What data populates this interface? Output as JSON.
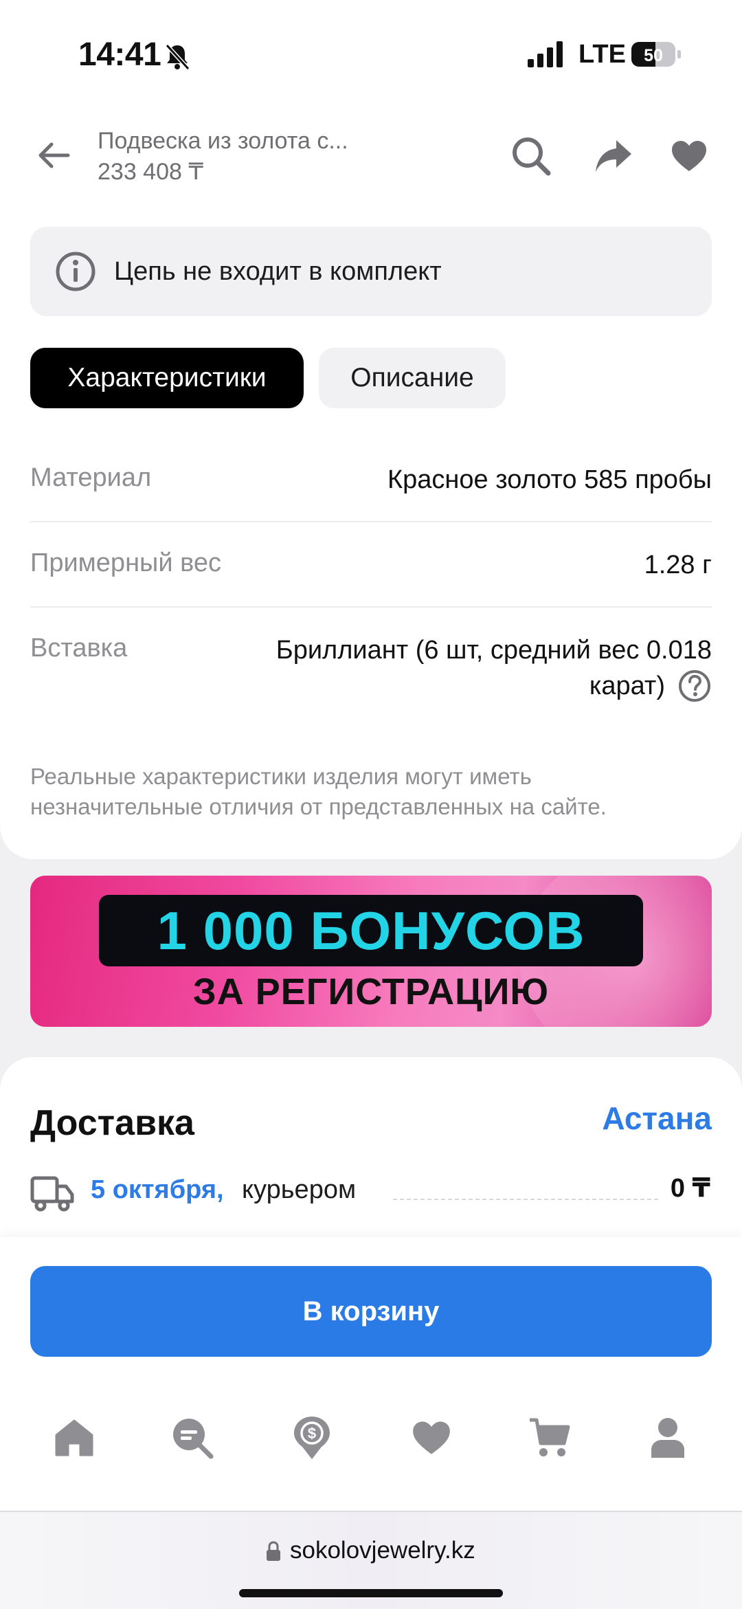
{
  "status_bar": {
    "time": "14:41",
    "network": "LTE",
    "battery": "50"
  },
  "header": {
    "title": "Подвеска из золота с...",
    "price": "233 408 ₸"
  },
  "notice": {
    "text": "Цепь не входит в комплект"
  },
  "tabs": [
    {
      "label": "Характеристики",
      "active": true
    },
    {
      "label": "Описание",
      "active": false
    }
  ],
  "specs": [
    {
      "label": "Материал",
      "value": "Красное золото 585 пробы"
    },
    {
      "label": "Примерный вес",
      "value": "1.28 г"
    },
    {
      "label": "Вставка",
      "value_line1": "Бриллиант (6 шт, средний вес 0.018",
      "value_line2": "карат)"
    }
  ],
  "disclaimer": {
    "line1": "Реальные характеристики изделия могут иметь",
    "line2": "незначительные отличия от представленных на сайте."
  },
  "banner": {
    "line1": "1 000 БОНУСОВ",
    "line2": "ЗА РЕГИСТРАЦИЮ"
  },
  "delivery": {
    "title": "Доставка",
    "city": "Астана",
    "date": "5 октября,",
    "method": "курьером",
    "price": "0 ₸"
  },
  "cart_button": {
    "label": "В корзину"
  },
  "bottom_nav": [
    "home-icon",
    "catalog-search-icon",
    "bonus-icon",
    "favorites-icon",
    "cart-icon",
    "profile-icon"
  ],
  "url_bar": {
    "domain": "sokolovjewelry.kz"
  },
  "colors": {
    "accent": "#2b7be6",
    "link": "#2d7be5",
    "banner_text": "#22d4e6",
    "icon_gray": "#8e8e93"
  }
}
